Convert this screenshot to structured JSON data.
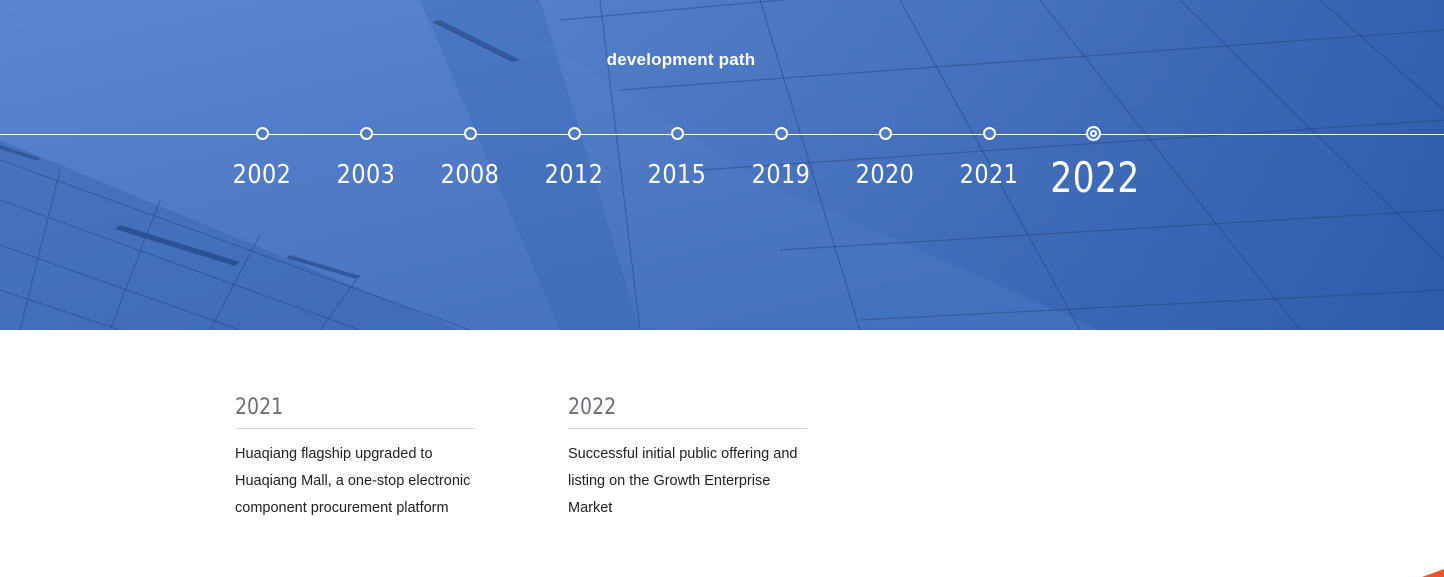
{
  "hero": {
    "title": "development path",
    "timeline": [
      {
        "year": "2002",
        "active": false
      },
      {
        "year": "2003",
        "active": false
      },
      {
        "year": "2008",
        "active": false
      },
      {
        "year": "2012",
        "active": false
      },
      {
        "year": "2015",
        "active": false
      },
      {
        "year": "2019",
        "active": false
      },
      {
        "year": "2020",
        "active": false
      },
      {
        "year": "2021",
        "active": false
      },
      {
        "year": "2022",
        "active": true
      }
    ]
  },
  "events": [
    {
      "year": "2021",
      "text": "Huaqiang flagship upgraded to Huaqiang Mall, a one-stop electronic component procurement platform"
    },
    {
      "year": "2022",
      "text": "Successful initial public offering and listing on the Growth Enterprise Market"
    }
  ],
  "colors": {
    "hero_bg": "#4f7cc8",
    "accent_corner": "#e8572a"
  }
}
